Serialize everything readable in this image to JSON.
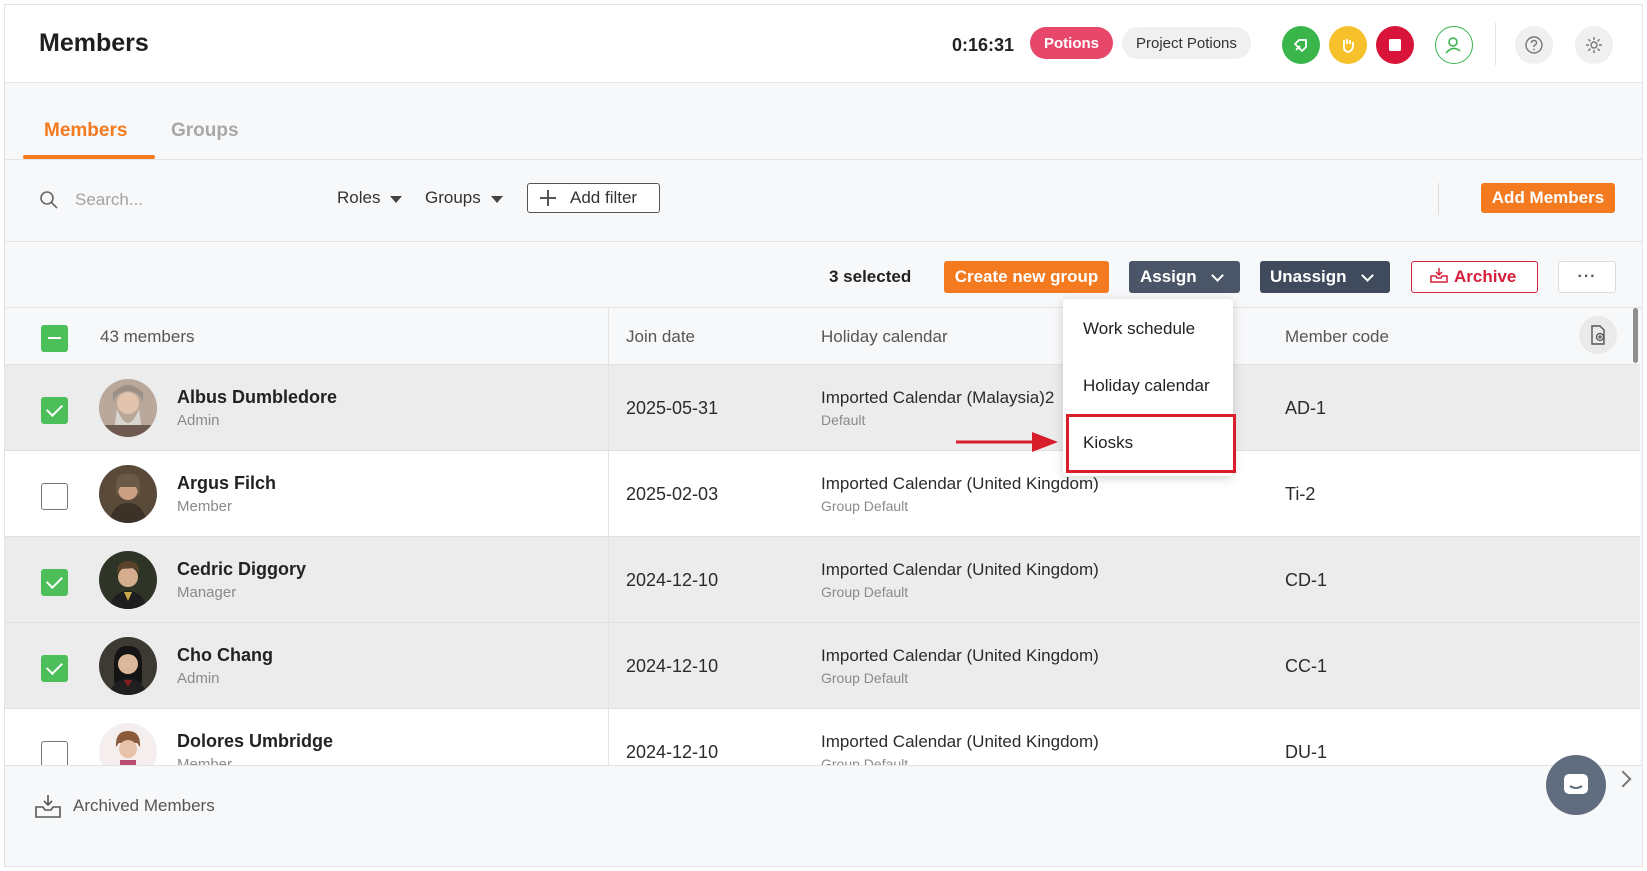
{
  "header": {
    "title": "Members",
    "timer": "0:16:31",
    "tag_potions": "Potions",
    "tag_project": "Project Potions",
    "icons": [
      "rocket-icon",
      "hand-icon",
      "stop-icon",
      "user-icon",
      "help-icon",
      "settings-icon"
    ]
  },
  "tabs": {
    "members": "Members",
    "groups": "Groups"
  },
  "filters": {
    "search_placeholder": "Search...",
    "roles": "Roles",
    "groups": "Groups",
    "add_filter": "Add filter",
    "add_members": "Add Members"
  },
  "actions": {
    "selected": "3 selected",
    "create_group": "Create new group",
    "assign": "Assign",
    "unassign": "Unassign",
    "archive": "Archive",
    "more": "···"
  },
  "assign_menu": {
    "items": [
      "Work schedule",
      "Holiday calendar",
      "Kiosks"
    ],
    "highlighted": "Kiosks"
  },
  "table": {
    "count_label": "43 members",
    "columns": {
      "join_date": "Join date",
      "holiday_calendar": "Holiday calendar",
      "member_code": "Member code"
    },
    "rows": [
      {
        "name": "Albus Dumbledore",
        "role": "Admin",
        "join_date": "2025-05-31",
        "calendar": "Imported Calendar (Malaysia)2",
        "calendar_sub": "Default",
        "code": "AD-1",
        "selected": true
      },
      {
        "name": "Argus Filch",
        "role": "Member",
        "join_date": "2025-02-03",
        "calendar": "Imported Calendar (United Kingdom)",
        "calendar_sub": "Group Default",
        "code": "Ti-2",
        "selected": false
      },
      {
        "name": "Cedric Diggory",
        "role": "Manager",
        "join_date": "2024-12-10",
        "calendar": "Imported Calendar (United Kingdom)",
        "calendar_sub": "Group Default",
        "code": "CD-1",
        "selected": true
      },
      {
        "name": "Cho Chang",
        "role": "Admin",
        "join_date": "2024-12-10",
        "calendar": "Imported Calendar (United Kingdom)",
        "calendar_sub": "Group Default",
        "code": "CC-1",
        "selected": true
      },
      {
        "name": "Dolores Umbridge",
        "role": "Member",
        "join_date": "2024-12-10",
        "calendar": "Imported Calendar (United Kingdom)",
        "calendar_sub": "Group Default",
        "code": "DU-1",
        "selected": false
      }
    ]
  },
  "footer": {
    "archived": "Archived Members"
  },
  "colors": {
    "accent": "#f47a20",
    "potions_tag": "#e6476b",
    "assign_button": "#4a5667",
    "archive_red": "#d61f3a",
    "checkbox_green": "#4cbf5a",
    "highlight_red": "#d81e2a"
  }
}
